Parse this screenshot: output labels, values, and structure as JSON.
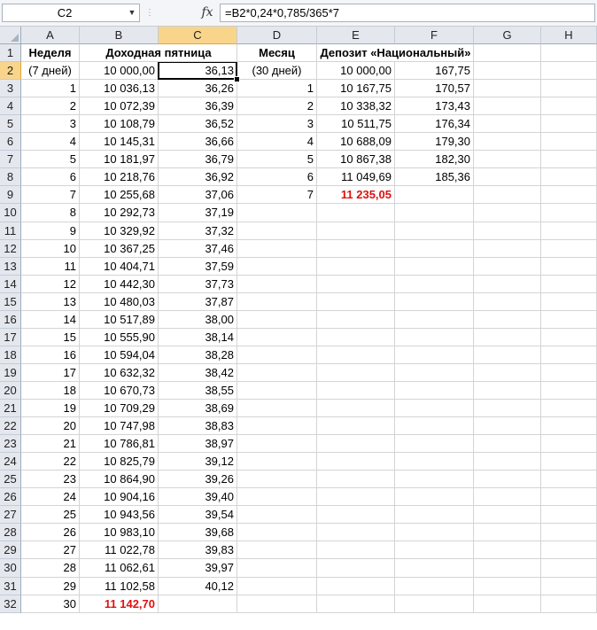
{
  "formula_bar": {
    "name_box": "C2",
    "fx_label": "fx",
    "formula": "=B2*0,24*0,785/365*7"
  },
  "columns": [
    "A",
    "B",
    "C",
    "D",
    "E",
    "F",
    "G",
    "H"
  ],
  "selected_cell": "C2",
  "rows": [
    {
      "n": "1",
      "cells": {
        "A": {
          "v": "Неделя",
          "s": "c b"
        },
        "B": {
          "v": "Доходная пятница",
          "s": "b span"
        },
        "D": {
          "v": "Месяц",
          "s": "c b"
        },
        "E": {
          "v": "Депозит «Национальный»",
          "s": "b span"
        }
      }
    },
    {
      "n": "2",
      "cells": {
        "A": {
          "v": "(7 дней)",
          "s": "c"
        },
        "B": {
          "v": "10 000,00",
          "s": "r"
        },
        "C": {
          "v": "36,13",
          "s": "r"
        },
        "D": {
          "v": "(30 дней)",
          "s": "c"
        },
        "E": {
          "v": "10 000,00",
          "s": "r"
        },
        "F": {
          "v": "167,75",
          "s": "r"
        }
      }
    },
    {
      "n": "3",
      "cells": {
        "A": {
          "v": "1",
          "s": "r"
        },
        "B": {
          "v": "10 036,13",
          "s": "r"
        },
        "C": {
          "v": "36,26",
          "s": "r"
        },
        "D": {
          "v": "1",
          "s": "r"
        },
        "E": {
          "v": "10 167,75",
          "s": "r"
        },
        "F": {
          "v": "170,57",
          "s": "r"
        }
      }
    },
    {
      "n": "4",
      "cells": {
        "A": {
          "v": "2",
          "s": "r"
        },
        "B": {
          "v": "10 072,39",
          "s": "r"
        },
        "C": {
          "v": "36,39",
          "s": "r"
        },
        "D": {
          "v": "2",
          "s": "r"
        },
        "E": {
          "v": "10 338,32",
          "s": "r"
        },
        "F": {
          "v": "173,43",
          "s": "r"
        }
      }
    },
    {
      "n": "5",
      "cells": {
        "A": {
          "v": "3",
          "s": "r"
        },
        "B": {
          "v": "10 108,79",
          "s": "r"
        },
        "C": {
          "v": "36,52",
          "s": "r"
        },
        "D": {
          "v": "3",
          "s": "r"
        },
        "E": {
          "v": "10 511,75",
          "s": "r"
        },
        "F": {
          "v": "176,34",
          "s": "r"
        }
      }
    },
    {
      "n": "6",
      "cells": {
        "A": {
          "v": "4",
          "s": "r"
        },
        "B": {
          "v": "10 145,31",
          "s": "r"
        },
        "C": {
          "v": "36,66",
          "s": "r"
        },
        "D": {
          "v": "4",
          "s": "r"
        },
        "E": {
          "v": "10 688,09",
          "s": "r"
        },
        "F": {
          "v": "179,30",
          "s": "r"
        }
      }
    },
    {
      "n": "7",
      "cells": {
        "A": {
          "v": "5",
          "s": "r"
        },
        "B": {
          "v": "10 181,97",
          "s": "r"
        },
        "C": {
          "v": "36,79",
          "s": "r"
        },
        "D": {
          "v": "5",
          "s": "r"
        },
        "E": {
          "v": "10 867,38",
          "s": "r"
        },
        "F": {
          "v": "182,30",
          "s": "r"
        }
      }
    },
    {
      "n": "8",
      "cells": {
        "A": {
          "v": "6",
          "s": "r"
        },
        "B": {
          "v": "10 218,76",
          "s": "r"
        },
        "C": {
          "v": "36,92",
          "s": "r"
        },
        "D": {
          "v": "6",
          "s": "r"
        },
        "E": {
          "v": "11 049,69",
          "s": "r"
        },
        "F": {
          "v": "185,36",
          "s": "r"
        }
      }
    },
    {
      "n": "9",
      "cells": {
        "A": {
          "v": "7",
          "s": "r"
        },
        "B": {
          "v": "10 255,68",
          "s": "r"
        },
        "C": {
          "v": "37,06",
          "s": "r"
        },
        "D": {
          "v": "7",
          "s": "r"
        },
        "E": {
          "v": "11 235,05",
          "s": "r red"
        }
      }
    },
    {
      "n": "10",
      "cells": {
        "A": {
          "v": "8",
          "s": "r"
        },
        "B": {
          "v": "10 292,73",
          "s": "r"
        },
        "C": {
          "v": "37,19",
          "s": "r"
        }
      }
    },
    {
      "n": "11",
      "cells": {
        "A": {
          "v": "9",
          "s": "r"
        },
        "B": {
          "v": "10 329,92",
          "s": "r"
        },
        "C": {
          "v": "37,32",
          "s": "r"
        }
      }
    },
    {
      "n": "12",
      "cells": {
        "A": {
          "v": "10",
          "s": "r"
        },
        "B": {
          "v": "10 367,25",
          "s": "r"
        },
        "C": {
          "v": "37,46",
          "s": "r"
        }
      }
    },
    {
      "n": "13",
      "cells": {
        "A": {
          "v": "11",
          "s": "r"
        },
        "B": {
          "v": "10 404,71",
          "s": "r"
        },
        "C": {
          "v": "37,59",
          "s": "r"
        }
      }
    },
    {
      "n": "14",
      "cells": {
        "A": {
          "v": "12",
          "s": "r"
        },
        "B": {
          "v": "10 442,30",
          "s": "r"
        },
        "C": {
          "v": "37,73",
          "s": "r"
        }
      }
    },
    {
      "n": "15",
      "cells": {
        "A": {
          "v": "13",
          "s": "r"
        },
        "B": {
          "v": "10 480,03",
          "s": "r"
        },
        "C": {
          "v": "37,87",
          "s": "r"
        }
      }
    },
    {
      "n": "16",
      "cells": {
        "A": {
          "v": "14",
          "s": "r"
        },
        "B": {
          "v": "10 517,89",
          "s": "r"
        },
        "C": {
          "v": "38,00",
          "s": "r"
        }
      }
    },
    {
      "n": "17",
      "cells": {
        "A": {
          "v": "15",
          "s": "r"
        },
        "B": {
          "v": "10 555,90",
          "s": "r"
        },
        "C": {
          "v": "38,14",
          "s": "r"
        }
      }
    },
    {
      "n": "18",
      "cells": {
        "A": {
          "v": "16",
          "s": "r"
        },
        "B": {
          "v": "10 594,04",
          "s": "r"
        },
        "C": {
          "v": "38,28",
          "s": "r"
        }
      }
    },
    {
      "n": "19",
      "cells": {
        "A": {
          "v": "17",
          "s": "r"
        },
        "B": {
          "v": "10 632,32",
          "s": "r"
        },
        "C": {
          "v": "38,42",
          "s": "r"
        }
      }
    },
    {
      "n": "20",
      "cells": {
        "A": {
          "v": "18",
          "s": "r"
        },
        "B": {
          "v": "10 670,73",
          "s": "r"
        },
        "C": {
          "v": "38,55",
          "s": "r"
        }
      }
    },
    {
      "n": "21",
      "cells": {
        "A": {
          "v": "19",
          "s": "r"
        },
        "B": {
          "v": "10 709,29",
          "s": "r"
        },
        "C": {
          "v": "38,69",
          "s": "r"
        }
      }
    },
    {
      "n": "22",
      "cells": {
        "A": {
          "v": "20",
          "s": "r"
        },
        "B": {
          "v": "10 747,98",
          "s": "r"
        },
        "C": {
          "v": "38,83",
          "s": "r"
        }
      }
    },
    {
      "n": "23",
      "cells": {
        "A": {
          "v": "21",
          "s": "r"
        },
        "B": {
          "v": "10 786,81",
          "s": "r"
        },
        "C": {
          "v": "38,97",
          "s": "r"
        }
      }
    },
    {
      "n": "24",
      "cells": {
        "A": {
          "v": "22",
          "s": "r"
        },
        "B": {
          "v": "10 825,79",
          "s": "r"
        },
        "C": {
          "v": "39,12",
          "s": "r"
        }
      }
    },
    {
      "n": "25",
      "cells": {
        "A": {
          "v": "23",
          "s": "r"
        },
        "B": {
          "v": "10 864,90",
          "s": "r"
        },
        "C": {
          "v": "39,26",
          "s": "r"
        }
      }
    },
    {
      "n": "26",
      "cells": {
        "A": {
          "v": "24",
          "s": "r"
        },
        "B": {
          "v": "10 904,16",
          "s": "r"
        },
        "C": {
          "v": "39,40",
          "s": "r"
        }
      }
    },
    {
      "n": "27",
      "cells": {
        "A": {
          "v": "25",
          "s": "r"
        },
        "B": {
          "v": "10 943,56",
          "s": "r"
        },
        "C": {
          "v": "39,54",
          "s": "r"
        }
      }
    },
    {
      "n": "28",
      "cells": {
        "A": {
          "v": "26",
          "s": "r"
        },
        "B": {
          "v": "10 983,10",
          "s": "r"
        },
        "C": {
          "v": "39,68",
          "s": "r"
        }
      }
    },
    {
      "n": "29",
      "cells": {
        "A": {
          "v": "27",
          "s": "r"
        },
        "B": {
          "v": "11 022,78",
          "s": "r"
        },
        "C": {
          "v": "39,83",
          "s": "r"
        }
      }
    },
    {
      "n": "30",
      "cells": {
        "A": {
          "v": "28",
          "s": "r"
        },
        "B": {
          "v": "11 062,61",
          "s": "r"
        },
        "C": {
          "v": "39,97",
          "s": "r"
        }
      }
    },
    {
      "n": "31",
      "cells": {
        "A": {
          "v": "29",
          "s": "r"
        },
        "B": {
          "v": "11 102,58",
          "s": "r"
        },
        "C": {
          "v": "40,12",
          "s": "r"
        }
      }
    },
    {
      "n": "32",
      "cells": {
        "A": {
          "v": "30",
          "s": "r"
        },
        "B": {
          "v": "11 142,70",
          "s": "r red"
        }
      }
    }
  ]
}
